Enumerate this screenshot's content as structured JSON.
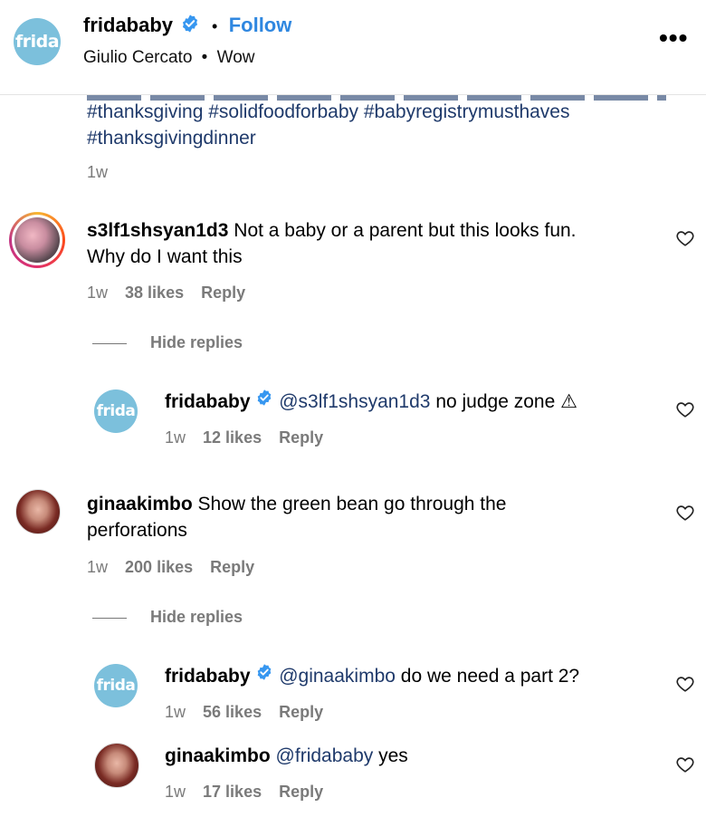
{
  "header": {
    "username": "fridababy",
    "separator": "•",
    "follow_label": "Follow",
    "sub_user": "Giulio Cercato",
    "sub_separator": "•",
    "sub_text": "Wow",
    "more_icon": "more-horizontal-icon",
    "logo_text": "frida"
  },
  "caption": {
    "hashtags_line1": "#thanksgiving #solidfoodforbaby #babyregistrymusthaves",
    "hashtags_line2": "#thanksgivingdinner",
    "time": "1w"
  },
  "comments": [
    {
      "username": "s3lf1shsyan1d3",
      "text_line1": "Not a baby or a parent but this looks fun.",
      "text_line2": "Why do I want this",
      "time": "1w",
      "likes": "38 likes",
      "reply": "Reply",
      "hide_replies": "Hide replies",
      "replies": [
        {
          "username": "fridababy",
          "mention": "@s3lf1shsyan1d3",
          "text": "no judge zone ⚠",
          "time": "1w",
          "likes": "12 likes",
          "reply": "Reply"
        }
      ]
    },
    {
      "username": "ginaakimbo",
      "text_line1": "Show the green bean go through the",
      "text_line2": "perforations",
      "time": "1w",
      "likes": "200 likes",
      "reply": "Reply",
      "hide_replies": "Hide replies",
      "replies": [
        {
          "username": "fridababy",
          "mention": "@ginaakimbo",
          "text": "do we need a part 2?",
          "time": "1w",
          "likes": "56 likes",
          "reply": "Reply"
        },
        {
          "username": "ginaakimbo",
          "mention": "@fridababy",
          "text": "yes",
          "time": "1w",
          "likes": "17 likes",
          "reply": "Reply"
        }
      ]
    }
  ],
  "colors": {
    "follow": "#2f87e0",
    "hashtag": "#1f3a6b",
    "frida_logo": "#7cc0dc",
    "verified": "#3797f0",
    "muted": "#7a7a7a"
  }
}
